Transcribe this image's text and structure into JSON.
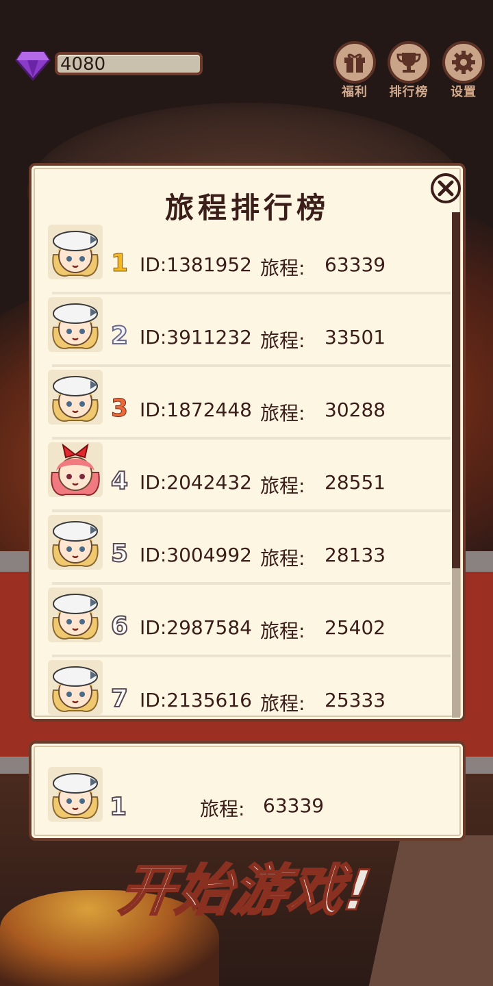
{
  "hud": {
    "gems": "4080",
    "buttons": [
      {
        "label": "福利",
        "icon": "gift-icon"
      },
      {
        "label": "排行榜",
        "icon": "trophy-icon"
      },
      {
        "label": "设置",
        "icon": "gear-icon"
      }
    ]
  },
  "leaderboard": {
    "title": "旅程排行榜",
    "rows": [
      {
        "rank": "1",
        "id": "ID:1381952",
        "label": "旅程:",
        "score": "63339",
        "avatar": "sailor-girl-avatar"
      },
      {
        "rank": "2",
        "id": "ID:3911232",
        "label": "旅程:",
        "score": "33501",
        "avatar": "sailor-girl-avatar"
      },
      {
        "rank": "3",
        "id": "ID:1872448",
        "label": "旅程:",
        "score": "30288",
        "avatar": "sailor-girl-avatar"
      },
      {
        "rank": "4",
        "id": "ID:2042432",
        "label": "旅程:",
        "score": "28551",
        "avatar": "pink-hair-girl-avatar"
      },
      {
        "rank": "5",
        "id": "ID:3004992",
        "label": "旅程:",
        "score": "28133",
        "avatar": "sailor-girl-avatar"
      },
      {
        "rank": "6",
        "id": "ID:2987584",
        "label": "旅程:",
        "score": "25402",
        "avatar": "sailor-girl-avatar"
      },
      {
        "rank": "7",
        "id": "ID:2135616",
        "label": "旅程:",
        "score": "25333",
        "avatar": "sailor-girl-avatar"
      }
    ]
  },
  "me": {
    "rank": "1",
    "label": "旅程:",
    "score": "63339",
    "avatar": "sailor-girl-avatar"
  },
  "start": {
    "label": "开始游戏!"
  },
  "colors": {
    "panel_bg": "#fdf6e3",
    "border": "#6a3a2a",
    "text": "#3b1e1a",
    "gold": "#f2b824",
    "bronze": "#e86a3a"
  }
}
